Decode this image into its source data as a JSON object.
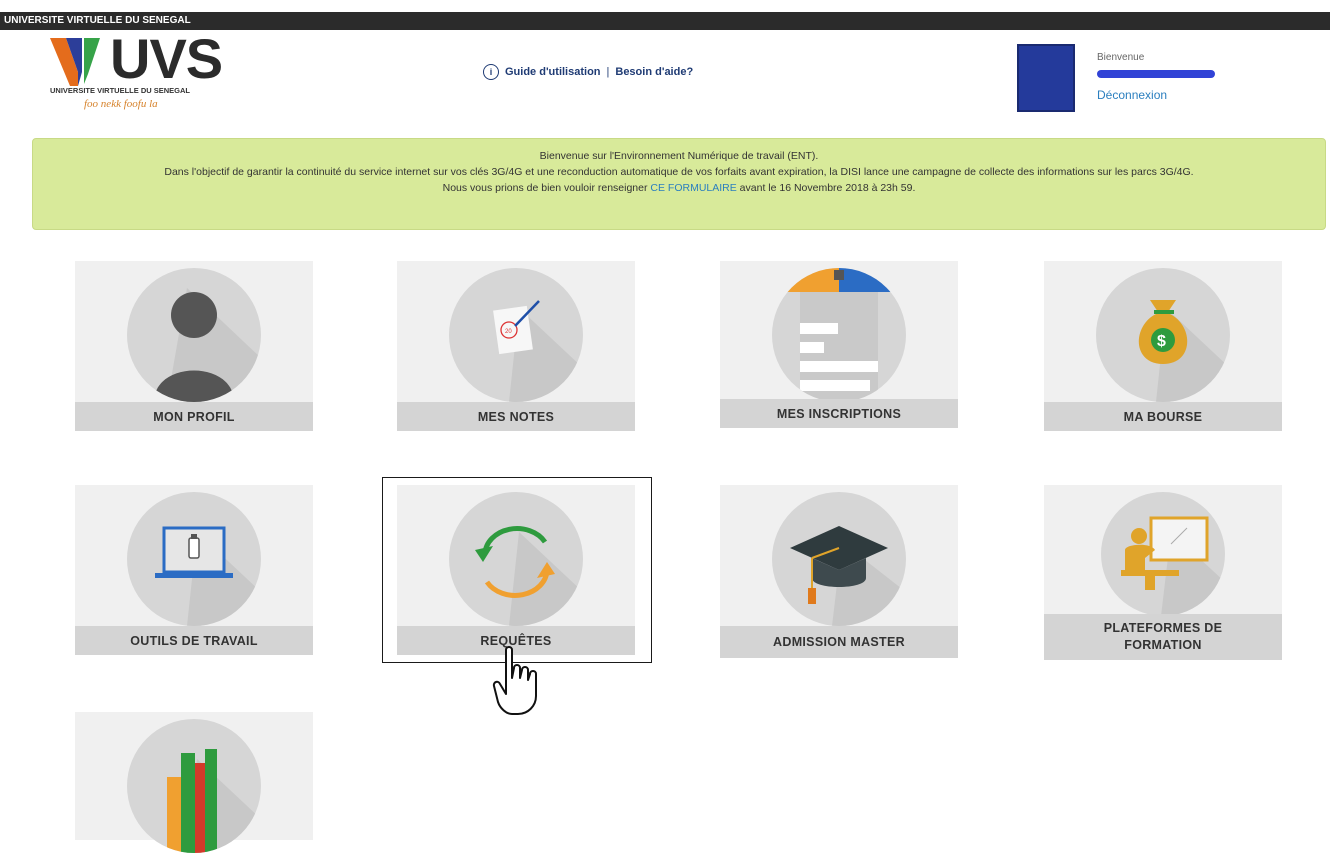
{
  "topbar": {
    "title": "UNIVERSITE VIRTUELLE DU SENEGAL"
  },
  "header": {
    "logo_text": "UVS",
    "logo_subtitle": "UNIVERSITE VIRTUELLE DU SENEGAL",
    "logo_tagline": "foo nekk foofu la",
    "help_guide": "Guide d'utilisation",
    "help_separator": "|",
    "help_support": "Besoin d'aide?",
    "welcome": "Bienvenue",
    "logout": "Déconnexion"
  },
  "banner": {
    "line1": "Bienvenue sur l'Environnement Numérique de travail (ENT).",
    "line2": "Dans l'objectif de garantir la continuité du service internet sur vos clés 3G/4G et une reconduction automatique de vos forfaits avant expiration, la DISI lance une campagne de collecte des informations sur les parcs 3G/4G.",
    "line3_before": "Nous vous prions de bien vouloir renseigner",
    "line3_link": "CE FORMULAIRE",
    "line3_after": "avant le 16 Novembre 2018 à 23h 59."
  },
  "tiles": [
    {
      "label": "MON PROFIL",
      "icon": "user-icon"
    },
    {
      "label": "MES NOTES",
      "icon": "grade-sheet-icon"
    },
    {
      "label": "MES INSCRIPTIONS",
      "icon": "registration-form-icon"
    },
    {
      "label": "MA BOURSE",
      "icon": "money-bag-icon"
    },
    {
      "label": "OUTILS DE TRAVAIL",
      "icon": "laptop-usb-icon"
    },
    {
      "label": "REQUÊTES",
      "icon": "refresh-arrows-icon"
    },
    {
      "label": "ADMISSION MASTER",
      "icon": "graduation-cap-icon"
    },
    {
      "label": "PLATEFORMES DE FORMATION",
      "icon": "teacher-board-icon"
    },
    {
      "label": "",
      "icon": "books-icon"
    }
  ],
  "colors": {
    "accent_blue": "#2b7fbf",
    "banner_bg": "#d8ea9a",
    "orange": "#f0a030",
    "green": "#2e9b3e"
  }
}
